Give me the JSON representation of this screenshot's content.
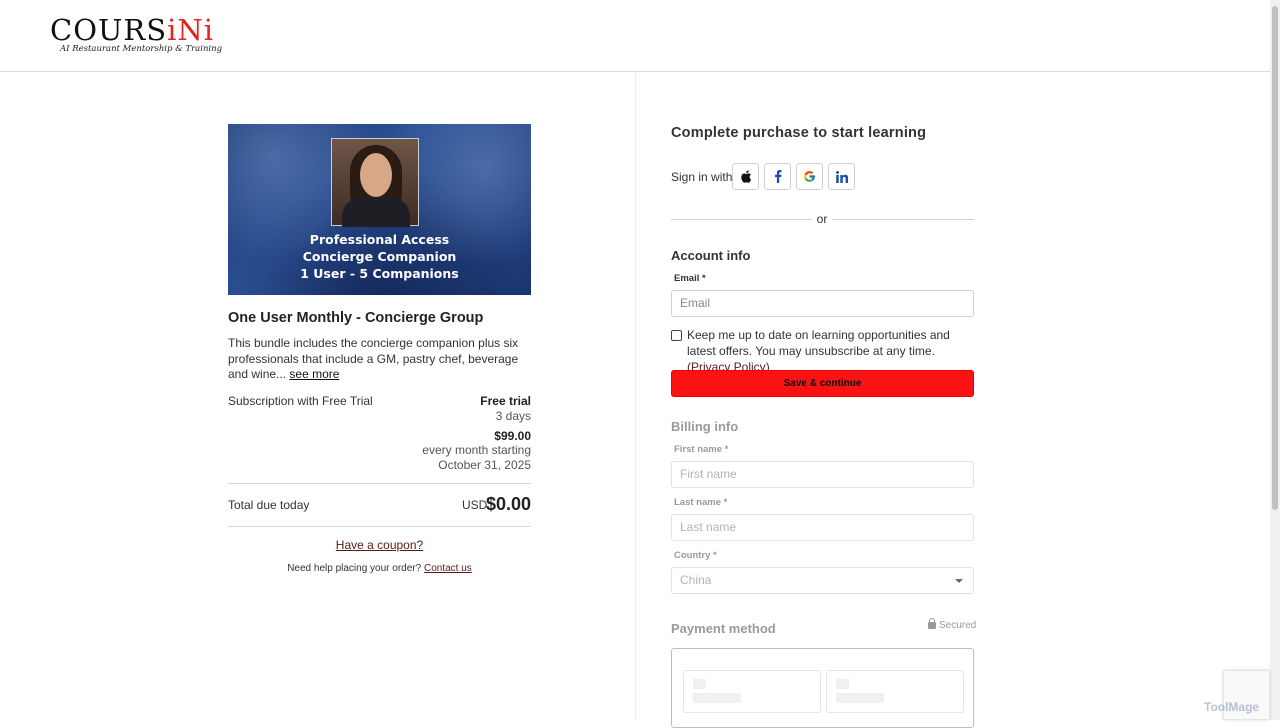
{
  "brand": {
    "logo_main_prefix": "COURS",
    "logo_main_accent": "iNi",
    "logo_tagline": "AI Restaurant Mentorship & Training",
    "accent_color": "#fb1212"
  },
  "product": {
    "banner_lines": [
      "Professional Access",
      "Concierge Companion",
      "1 User - 5 Companions"
    ],
    "title": "One User Monthly - Concierge Group",
    "description": "This bundle includes the concierge companion plus six professionals that include a GM, pastry chef, beverage and wine...",
    "see_more": "see more"
  },
  "pricing": {
    "plan_label": "Subscription with Free Trial",
    "trial_label": "Free trial",
    "trial_duration": "3 days",
    "price": "$99.00",
    "price_note": "every month starting October 31, 2025",
    "total_label": "Total due today",
    "currency": "USD",
    "total_value": "$0.00",
    "coupon_link": "Have a coupon?",
    "help_text": "Need help placing your order?",
    "contact_link": "Contact us"
  },
  "checkout": {
    "title": "Complete purchase to start learning",
    "signin_label": "Sign in with",
    "signin_providers": [
      "apple-icon",
      "facebook-icon",
      "google-icon",
      "linkedin-icon"
    ],
    "or_text": "or",
    "account_section": "Account info",
    "email_label": "Email *",
    "email_placeholder": "Email",
    "newsletter_text": "Keep me up to date on learning opportunities and latest offers. You may unsubscribe at any time. (",
    "privacy_link": "Privacy Policy",
    "newsletter_close": ")",
    "newsletter_checked": false,
    "save_button": "Save & continue",
    "billing_section": "Billing info",
    "first_name_label": "First name *",
    "first_name_placeholder": "First name",
    "last_name_label": "Last name *",
    "last_name_placeholder": "Last name",
    "country_label": "Country *",
    "country_value": "China",
    "payment_section": "Payment method",
    "secured_label": "Secured"
  },
  "overlay": {
    "watermark": "ToolMage"
  }
}
